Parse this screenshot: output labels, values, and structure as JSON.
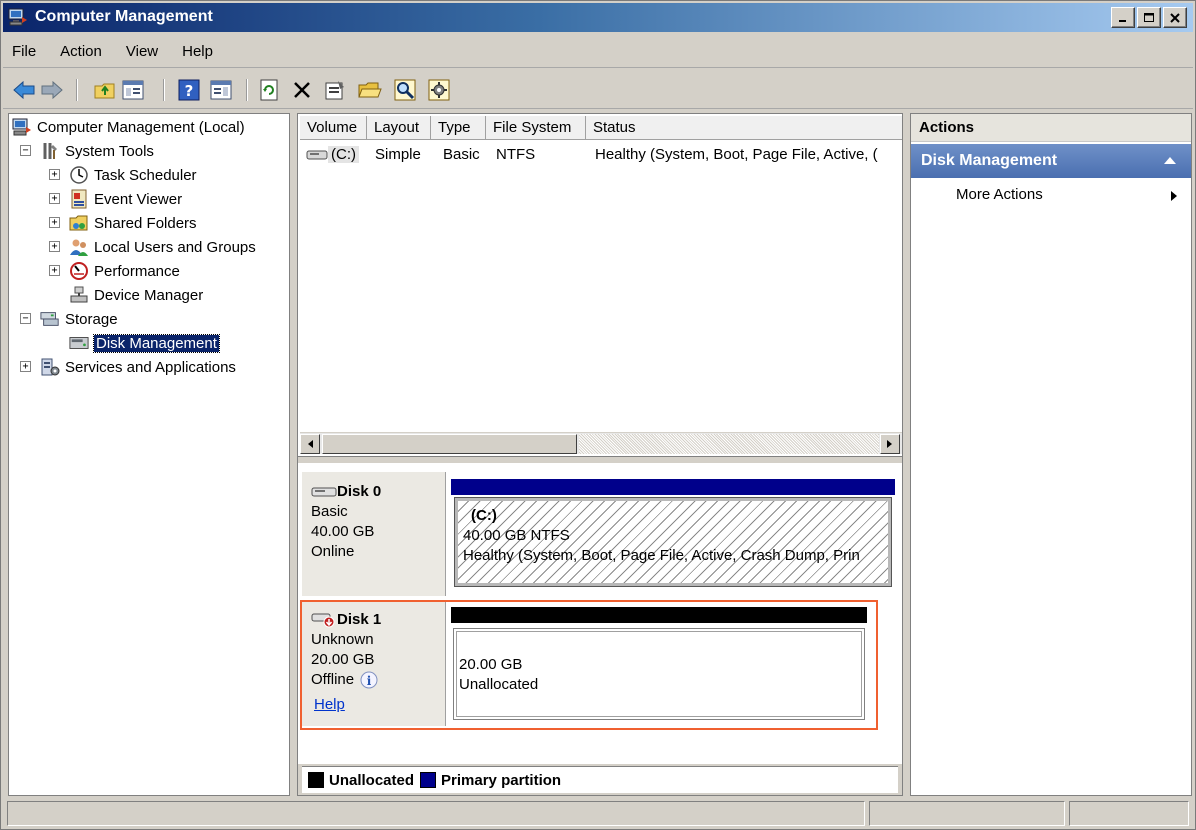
{
  "window": {
    "title": "Computer Management"
  },
  "menu": [
    "File",
    "Action",
    "View",
    "Help"
  ],
  "icons": {
    "back": "arrow-left-icon",
    "forward": "arrow-right-icon",
    "up": "folder-up-icon",
    "show_tree": "console-tree-icon",
    "help": "help-icon",
    "show_action": "action-pane-icon",
    "refresh": "refresh-icon",
    "delete": "delete-icon",
    "properties": "properties-icon",
    "open": "open-folder-icon",
    "search": "magnify-icon",
    "settings": "settings-icon"
  },
  "tree": {
    "root": "Computer Management (Local)",
    "system_tools": "System Tools",
    "task_scheduler": "Task Scheduler",
    "event_viewer": "Event Viewer",
    "shared_folders": "Shared Folders",
    "local_users": "Local Users and Groups",
    "performance": "Performance",
    "device_manager": "Device Manager",
    "storage": "Storage",
    "disk_management": "Disk Management",
    "services": "Services and Applications"
  },
  "volumes": {
    "headers": [
      "Volume",
      "Layout",
      "Type",
      "File System",
      "Status"
    ],
    "rows": [
      {
        "volume": "(C:)",
        "layout": "Simple",
        "type": "Basic",
        "fs": "NTFS",
        "status": "Healthy (System, Boot, Page File, Active, ("
      }
    ]
  },
  "disks": [
    {
      "name": "Disk 0",
      "kind": "Basic",
      "size": "40.00 GB",
      "state": "Online",
      "bar_color": "#00008b",
      "partition": {
        "label": "(C:)",
        "size": "40.00 GB NTFS",
        "status": "Healthy (System, Boot, Page File, Active, Crash Dump, Prin"
      }
    },
    {
      "name": "Disk 1",
      "kind": "Unknown",
      "size": "20.00 GB",
      "state": "Offline",
      "help": "Help",
      "bar_color": "#000000",
      "partition": {
        "size": "20.00 GB",
        "status": "Unallocated"
      }
    }
  ],
  "legend": [
    {
      "label": "Unallocated",
      "color": "#000000"
    },
    {
      "label": "Primary partition",
      "color": "#00008b"
    }
  ],
  "actions": {
    "header": "Actions",
    "group": "Disk Management",
    "item": "More Actions"
  },
  "colors": {
    "highlight": "#f06030",
    "selection": "#0a246a",
    "actions_group": "#4a6fb0"
  }
}
